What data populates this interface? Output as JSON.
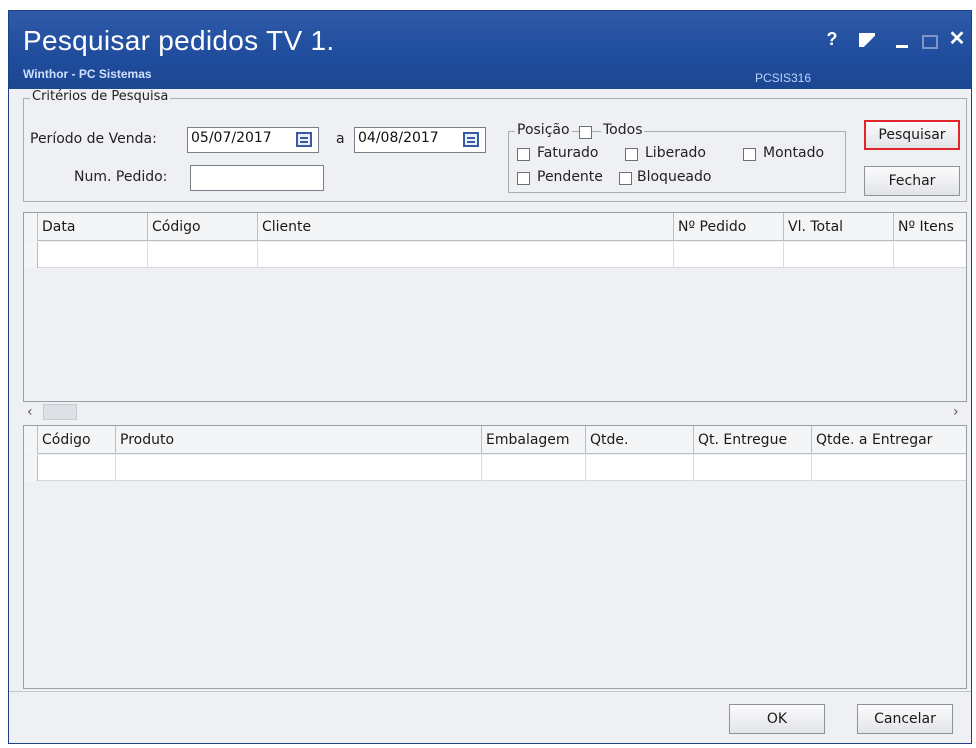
{
  "window": {
    "title": "Pesquisar pedidos TV 1.",
    "subtitle": "Winthor - PC Sistemas",
    "code": "PCSIS316",
    "help_glyph": "?",
    "close_glyph": "✕"
  },
  "criteria": {
    "legend": "Critérios de Pesquisa",
    "periodo_label": "Período de Venda:",
    "date_from": "05/07/2017",
    "between_label": "a",
    "date_to": "04/08/2017",
    "num_pedido_label": "Num. Pedido:",
    "num_pedido_value": ""
  },
  "posicao": {
    "label": "Posição",
    "todos": "Todos",
    "faturado": "Faturado",
    "liberado": "Liberado",
    "montado": "Montado",
    "pendente": "Pendente",
    "bloqueado": "Bloqueado"
  },
  "buttons": {
    "pesquisar": "Pesquisar",
    "fechar": "Fechar",
    "ok": "OK",
    "cancelar": "Cancelar"
  },
  "orders_table": {
    "columns": [
      "Data",
      "Código",
      "Cliente",
      "Nº Pedido",
      "Vl. Total",
      "Nº Itens"
    ]
  },
  "items_table": {
    "columns": [
      "Código",
      "Produto",
      "Embalagem",
      "Qtde.",
      "Qt. Entregue",
      "Qtde. a Entregar"
    ]
  },
  "scrollbar": {
    "left_arrow": "‹",
    "right_arrow": "›"
  },
  "colors": {
    "titlebar": "#1f4c9d",
    "highlight_border": "#e0262a",
    "window_bg": "#eef0f3"
  }
}
